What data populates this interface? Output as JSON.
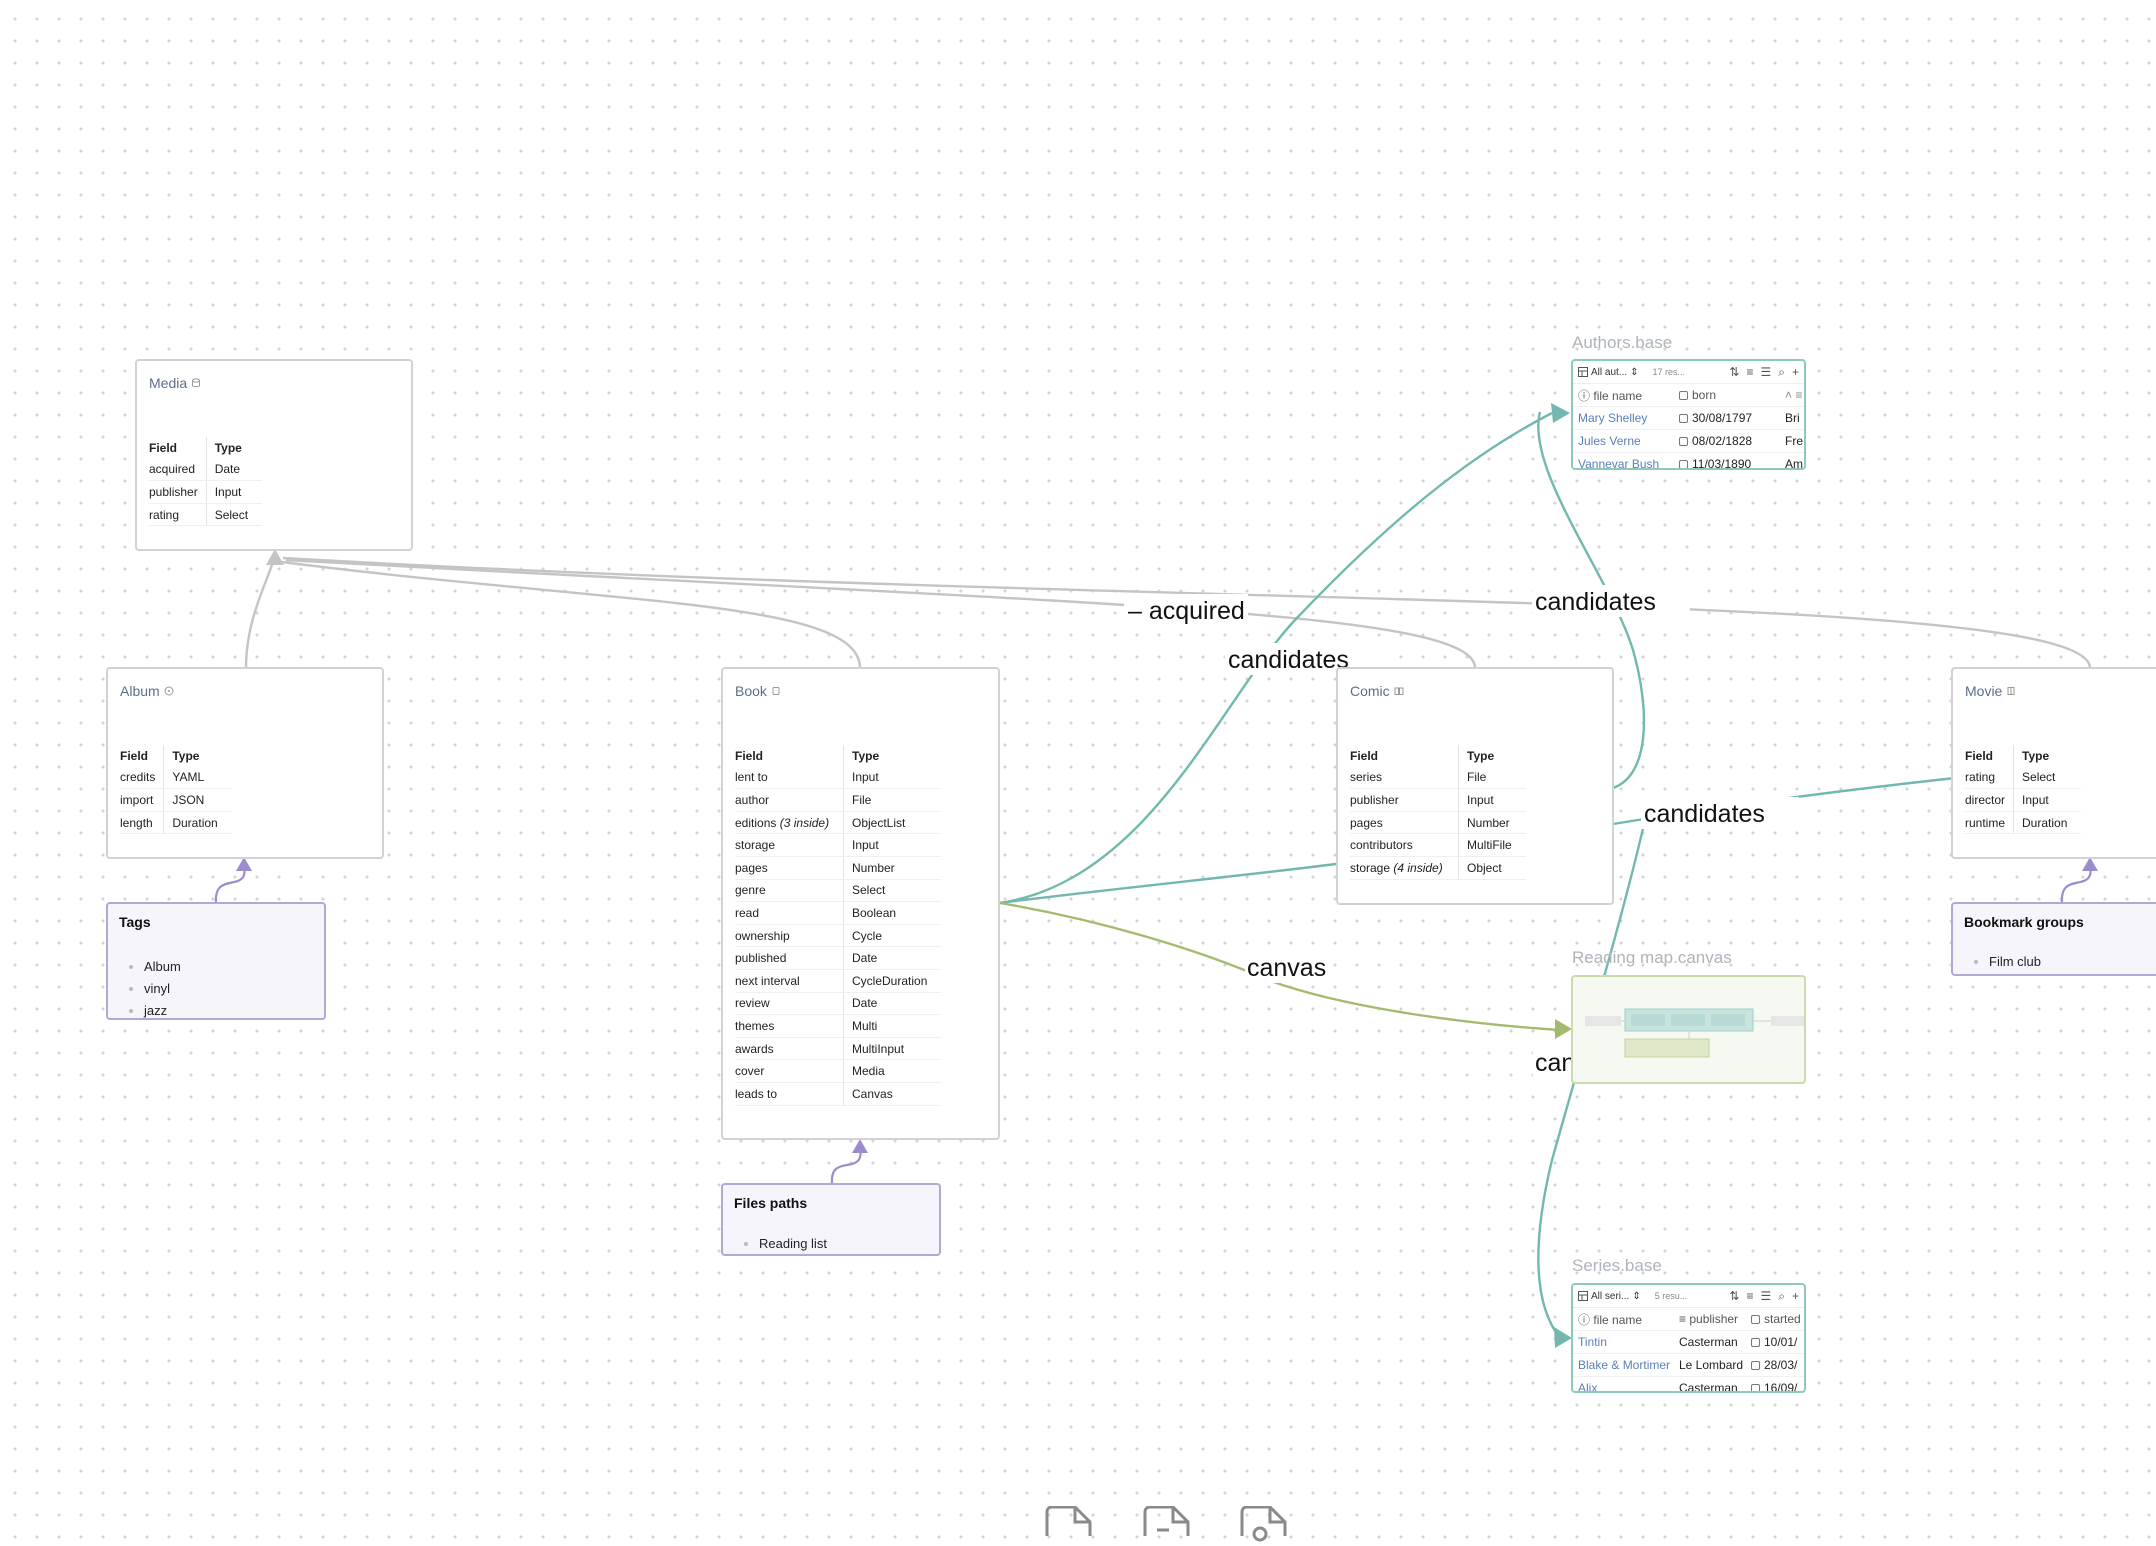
{
  "colors": {
    "gray_edge": "#c4c4c4",
    "teal_edge": "#72b8ae",
    "green_edge": "#a4ba6e",
    "purple_edge": "#9d8ccd",
    "note_border": "#b4a7d6",
    "embed_border": "#8ec9c0",
    "canvas_border": "#c8dcae"
  },
  "cards": {
    "media": {
      "title": "Media",
      "icon": "database-icon",
      "header": [
        "Field",
        "Type"
      ],
      "rows": [
        [
          "acquired",
          "Date"
        ],
        [
          "publisher",
          "Input"
        ],
        [
          "rating",
          "Select"
        ]
      ]
    },
    "album": {
      "title": "Album",
      "icon": "disc-icon",
      "header": [
        "Field",
        "Type"
      ],
      "rows": [
        [
          "credits",
          "YAML"
        ],
        [
          "import",
          "JSON"
        ],
        [
          "length",
          "Duration"
        ]
      ]
    },
    "book": {
      "title": "Book",
      "icon": "book-icon",
      "header": [
        "Field",
        "Type"
      ],
      "rows": [
        [
          "lent to",
          "Input"
        ],
        [
          "author",
          "File"
        ],
        [
          "editions",
          "(3 inside)",
          "ObjectList"
        ],
        [
          "storage",
          "Input"
        ],
        [
          "pages",
          "Number"
        ],
        [
          "genre",
          "Select"
        ],
        [
          "read",
          "Boolean"
        ],
        [
          "ownership",
          "Cycle"
        ],
        [
          "published",
          "Date"
        ],
        [
          "next interval",
          "CycleDuration"
        ],
        [
          "review",
          "Date"
        ],
        [
          "themes",
          "Multi"
        ],
        [
          "awards",
          "MultiInput"
        ],
        [
          "cover",
          "Media"
        ],
        [
          "leads to",
          "Canvas"
        ]
      ]
    },
    "comic": {
      "title": "Comic",
      "icon": "book-open-icon",
      "header": [
        "Field",
        "Type"
      ],
      "rows": [
        [
          "series",
          "File"
        ],
        [
          "publisher",
          "Input"
        ],
        [
          "pages",
          "Number"
        ],
        [
          "contributors",
          "MultiFile"
        ],
        [
          "storage",
          "(4 inside)",
          "Object"
        ]
      ]
    },
    "movie": {
      "title": "Movie",
      "icon": "film-icon",
      "header": [
        "Field",
        "Type"
      ],
      "rows": [
        [
          "rating",
          "Select"
        ],
        [
          "director",
          "Input"
        ],
        [
          "runtime",
          "Duration"
        ]
      ]
    }
  },
  "notes": {
    "tags": {
      "title": "Tags",
      "items": [
        "Album",
        "vinyl",
        "jazz"
      ]
    },
    "files_paths": {
      "title": "Files paths",
      "items": [
        "Reading list"
      ]
    },
    "bookmark_groups": {
      "title": "Bookmark groups",
      "items": [
        "Film club"
      ]
    }
  },
  "embeds": {
    "authors": {
      "label": "Authors.base",
      "view": "All aut...",
      "count": "17 res...",
      "columns": [
        "file name",
        "born"
      ],
      "rows": [
        [
          "Mary Shelley",
          "30/08/1797",
          "Bri"
        ],
        [
          "Jules Verne",
          "08/02/1828",
          "Fre"
        ],
        [
          "Vannevar Bush",
          "11/03/1890",
          "Am"
        ]
      ]
    },
    "series": {
      "label": "Series.base",
      "view": "All seri...",
      "count": "5 resu...",
      "columns": [
        "file name",
        "publisher",
        "started"
      ],
      "rows": [
        [
          "Tintin",
          "Casterman",
          "10/01/"
        ],
        [
          "Blake & Mortimer",
          "Le Lombard",
          "28/03/"
        ],
        [
          "Alix",
          "Casterman",
          "16/09/"
        ]
      ]
    },
    "reading_map": {
      "label": "Reading map.canvas"
    }
  },
  "edge_labels": {
    "acquired": "– acquired",
    "candidates_book": "candidates",
    "candidates_top": "candidates",
    "candidates_comic": "candidates",
    "canvas": "canvas",
    "canvas_partial": "can"
  },
  "bottom_icons": [
    "file-icon",
    "file-minus-icon",
    "file-search-icon"
  ]
}
